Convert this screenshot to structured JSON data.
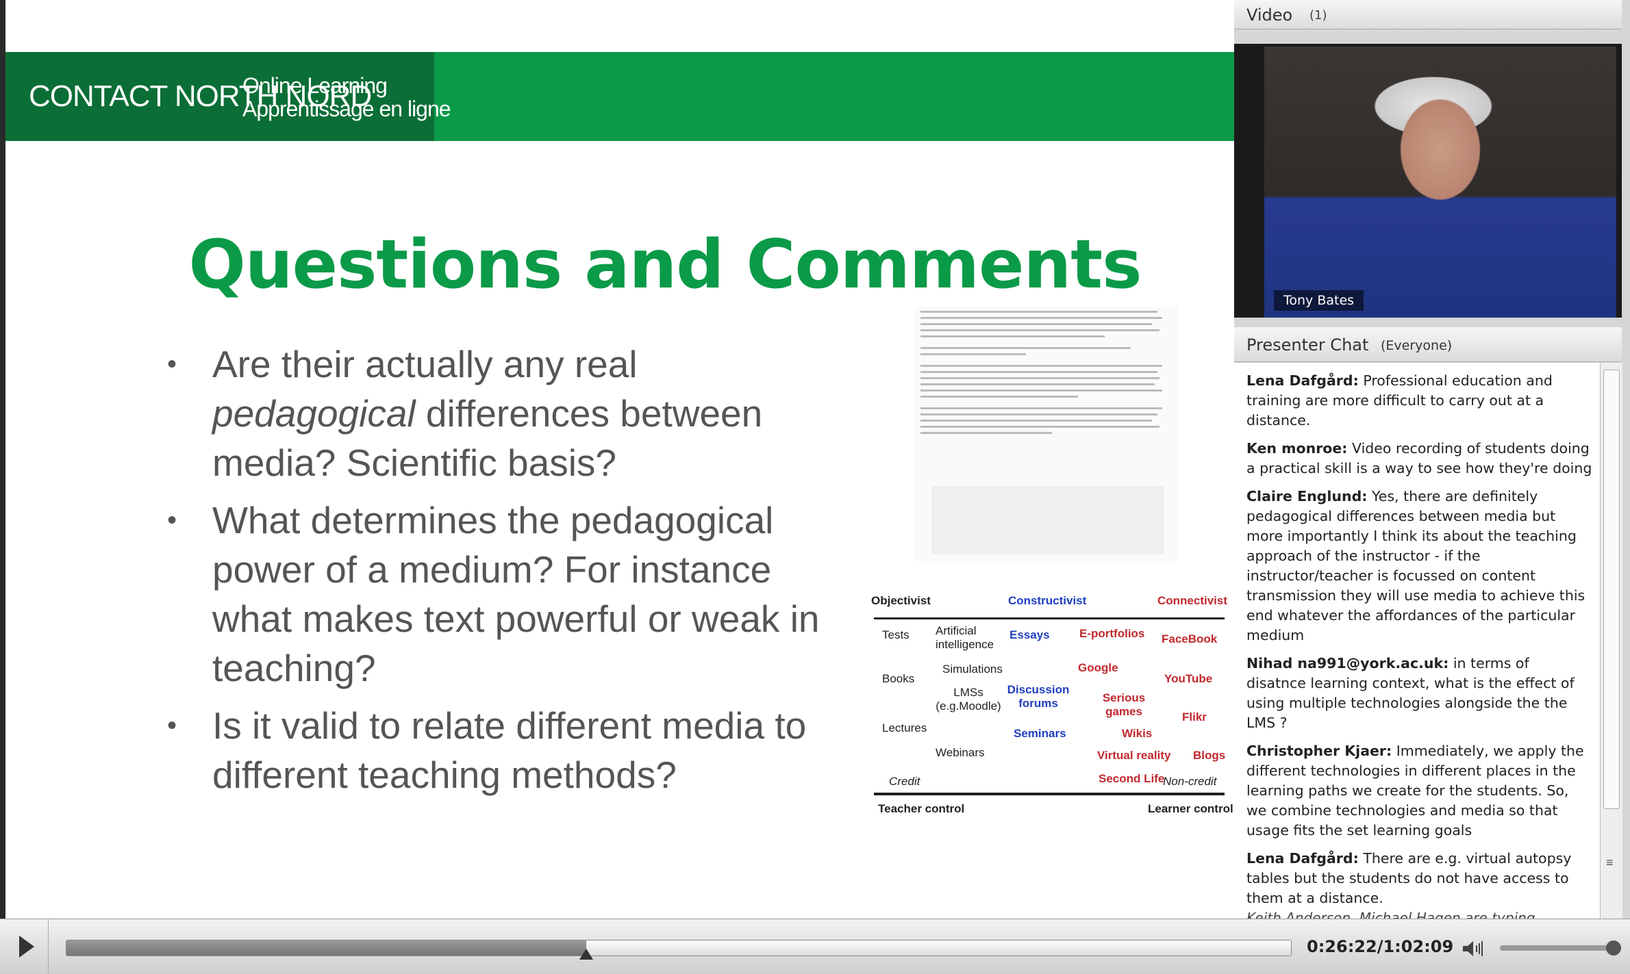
{
  "slide": {
    "logo_contact": "CONTACT NORTH NORD",
    "logo_line1": "Online Learning",
    "logo_line2": "Apprentissage en ligne",
    "title": "Questions and Comments",
    "bullets": [
      {
        "before": "Are their actually any real ",
        "italic": "pedagogical",
        "after": " differences between media? Scientific basis?"
      },
      {
        "before": "What determines the pedagogical power of a medium? For instance what makes text powerful or weak in teaching?",
        "italic": "",
        "after": ""
      },
      {
        "before": "Is it valid to relate different media to different teaching methods?",
        "italic": "",
        "after": ""
      }
    ],
    "diagram": {
      "headers": [
        "Objectivist",
        "Constructivist",
        "Connectivist"
      ],
      "left_labels": [
        "Tests",
        "Books",
        "Lectures",
        "Credit"
      ],
      "black_items": [
        "Artificial intelligence",
        "Simulations",
        "LMSs (e.g.Moodle)",
        "Webinars"
      ],
      "blue_items": [
        "Essays",
        "Discussion forums",
        "Seminars"
      ],
      "red_items": [
        "E-portfolios",
        "FaceBook",
        "Google",
        "YouTube",
        "Serious games",
        "Flikr",
        "Wikis",
        "Virtual reality",
        "Blogs",
        "Second Life"
      ],
      "non_credit": "Non-credit",
      "teacher_control": "Teacher control",
      "learner_control": "Learner control"
    }
  },
  "video": {
    "title": "Video",
    "count": "(1)",
    "presenter_name": "Tony Bates"
  },
  "chat": {
    "title": "Presenter Chat",
    "scope": "(Everyone)",
    "messages": [
      {
        "author": "Lena Dafgård:",
        "text": " Professional education and training are more difficult to carry out at a distance."
      },
      {
        "author": "Ken monroe:",
        "text": " Video recording of students doing a practical skill is a way to see how they're doing"
      },
      {
        "author": "Claire Englund:",
        "text": " Yes, there are definitely pedagogical differences between media but more importantly I think its about the teaching approach of the instructor - if the instructor/teacher is focussed on content transmission they will use media to achieve this end whatever the affordances of the particular medium"
      },
      {
        "author": "Nihad na991@york.ac.uk:",
        "text": " in terms of disatnce learning context, what is the effect of using multiple technologies alongside the the LMS ?"
      },
      {
        "author": "Christopher Kjaer:",
        "text": " Immediately, we apply the different technologies in different places in the learning paths we create for the students. So, we combine technologies and media so that usage fits the set learning goals"
      },
      {
        "author": "Lena Dafgård:",
        "text": " There are e.g. virtual autopsy tables but the students do not have access to them at a distance."
      }
    ],
    "typing": "Keith  Anderson, Michael Hagen are typing..."
  },
  "player": {
    "time": "0:26:22/1:02:09",
    "progress": 0.4243,
    "volume": 1.0
  }
}
